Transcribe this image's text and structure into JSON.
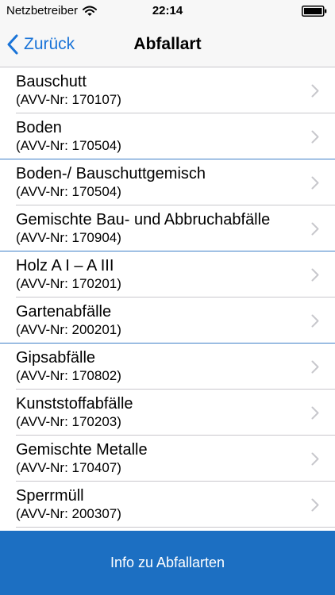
{
  "status_bar": {
    "carrier": "Netzbetreiber",
    "time": "22:14",
    "icons": [
      "wifi-icon",
      "battery-icon"
    ]
  },
  "nav": {
    "back_label": "Zurück",
    "title": "Abfallart",
    "back_icon": "chevron-left-icon"
  },
  "items": [
    {
      "title": "Bauschutt",
      "sub": "(AVV-Nr: 170107)"
    },
    {
      "title": "Boden",
      "sub": "(AVV-Nr: 170504)"
    },
    {
      "title": "Boden-/ Bauschuttgemisch",
      "sub": "(AVV-Nr: 170504)"
    },
    {
      "title": "Gemischte Bau- und Abbruchabfälle",
      "sub": "(AVV-Nr: 170904)"
    },
    {
      "title": "Holz A I – A III",
      "sub": "(AVV-Nr: 170201)"
    },
    {
      "title": "Gartenabfälle",
      "sub": "(AVV-Nr: 200201)"
    },
    {
      "title": "Gipsabfälle",
      "sub": "(AVV-Nr: 170802)"
    },
    {
      "title": "Kunststoffabfälle",
      "sub": "(AVV-Nr: 170203)"
    },
    {
      "title": "Gemischte Metalle",
      "sub": "(AVV-Nr: 170407)"
    },
    {
      "title": "Sperrmüll",
      "sub": "(AVV-Nr: 200307)"
    }
  ],
  "item_icon": "chevron-right-icon",
  "bottom_button": {
    "label": "Info zu Abfallarten"
  },
  "colors": {
    "accent": "#1a74d8",
    "bottom_bar": "#1c6fc2",
    "separator": "#c8c7cc",
    "separator_highlight": "#3d7fc7"
  }
}
